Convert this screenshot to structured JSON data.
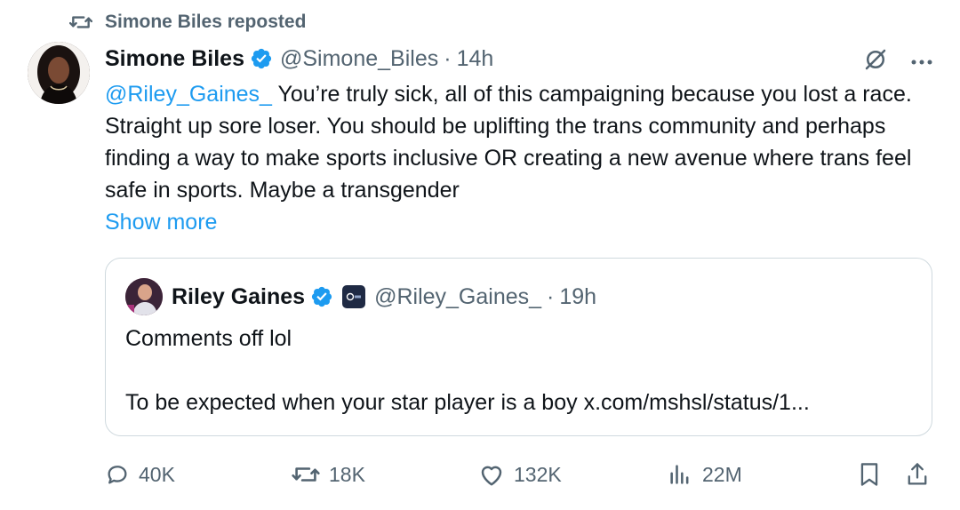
{
  "repost": {
    "label": "Simone Biles reposted"
  },
  "tweet": {
    "author_name": "Simone Biles",
    "handle": "@Simone_Biles",
    "separator": "·",
    "time": "14h",
    "mention": "@Riley_Gaines_",
    "text": " You’re truly sick, all of this campaigning because you lost a race. Straight up sore loser. You should be uplifting the trans community and perhaps finding a way to make sports inclusive OR creating a new avenue where trans feel safe in sports. Maybe a transgender",
    "show_more": "Show more"
  },
  "quote": {
    "author_name": "Riley Gaines",
    "handle": "@Riley_Gaines_",
    "separator": "·",
    "time": "19h",
    "line1": "Comments off lol",
    "line2": "To be expected when your star player is a boy x.com/mshsl/status/1..."
  },
  "actions": {
    "replies": "40K",
    "reposts": "18K",
    "likes": "132K",
    "views": "22M"
  },
  "icons": [
    "repost-icon",
    "verified-badge-icon",
    "grok-icon",
    "more-icon",
    "reply-icon",
    "like-icon",
    "views-icon",
    "bookmark-icon",
    "share-icon"
  ],
  "colors": {
    "accent": "#1d9bf0",
    "muted": "#536471",
    "text": "#0f1419",
    "border": "#cfd9de"
  }
}
